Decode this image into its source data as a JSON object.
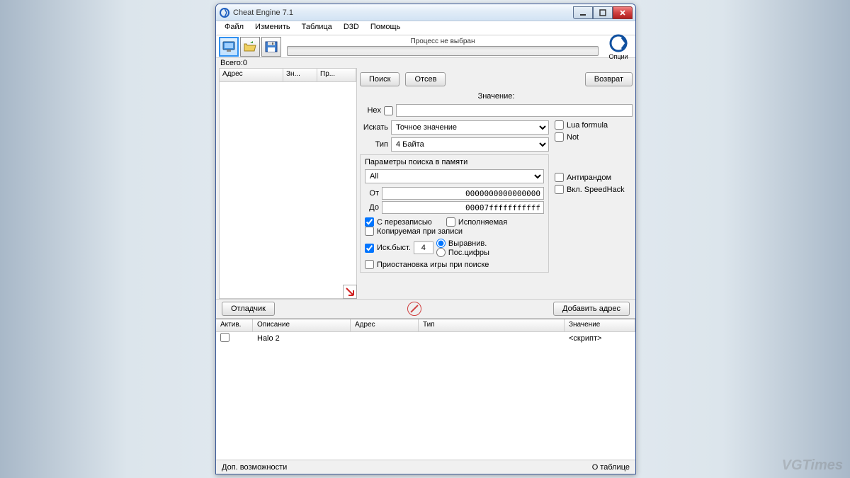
{
  "window": {
    "title": "Cheat Engine 7.1"
  },
  "menubar": [
    "Файл",
    "Изменить",
    "Таблица",
    "D3D",
    "Помощь"
  ],
  "toolbar": {
    "process_status": "Процесс не выбран",
    "options_label": "Опции"
  },
  "count": {
    "label": "Всего:",
    "value": "0"
  },
  "result_list": {
    "cols": [
      "Адрес",
      "Зн...",
      "Пр..."
    ]
  },
  "buttons": {
    "search": "Поиск",
    "filter": "Отсев",
    "revert": "Возврат",
    "debugger": "Отладчик",
    "add_address": "Добавить адрес"
  },
  "scan": {
    "value_label": "Значение:",
    "hex_label": "Hex",
    "search_label": "Искать",
    "search_type": "Точное значение",
    "type_label": "Тип",
    "value_type": "4 Байта",
    "lua_label": "Lua formula",
    "not_label": "Not"
  },
  "memory": {
    "title": "Параметры поиска в памяти",
    "region": "All",
    "from_label": "От",
    "from_value": "0000000000000000",
    "to_label": "До",
    "to_value": "00007fffffffffff",
    "writable": "С перезаписью",
    "executable": "Исполняемая",
    "cow": "Копируемая при записи",
    "fastscan": "Иск.быст.",
    "fastscan_value": "4",
    "align": "Выравнив.",
    "last_digits": "Пос.цифры",
    "pause": "Приостановка игры при поиске",
    "antirandom": "Антирандом",
    "speedhack": "Вкл. SpeedHack"
  },
  "table": {
    "cols": [
      "Актив.",
      "Описание",
      "Адрес",
      "Тип",
      "Значение"
    ],
    "rows": [
      {
        "active": false,
        "desc": "Halo 2",
        "addr": "",
        "type": "",
        "value": "<скрипт>"
      }
    ]
  },
  "statusbar": {
    "left": "Доп. возможности",
    "right": "О таблице"
  },
  "watermark": "VGTimes"
}
